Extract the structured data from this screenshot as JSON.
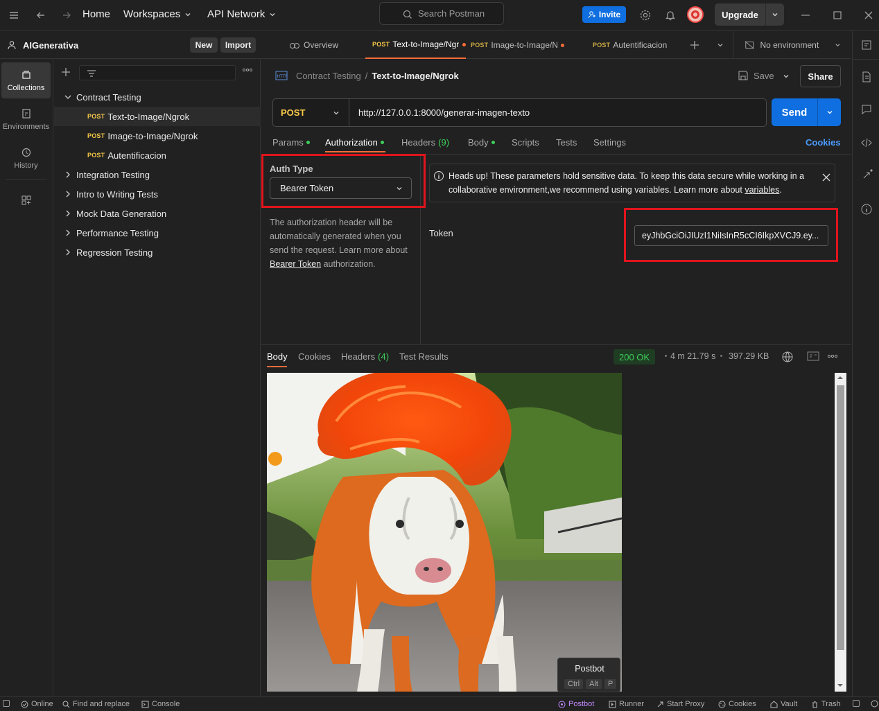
{
  "topbar": {
    "nav": {
      "home": "Home",
      "workspaces": "Workspaces",
      "api_network": "API Network"
    },
    "search_placeholder": "Search Postman",
    "invite_label": "Invite",
    "upgrade_label": "Upgrade"
  },
  "workspace": {
    "name": "AIGenerativa",
    "new_label": "New",
    "import_label": "Import"
  },
  "rail": [
    {
      "label": "Collections",
      "icon": "collections-icon"
    },
    {
      "label": "Environments",
      "icon": "environments-icon"
    },
    {
      "label": "History",
      "icon": "history-icon"
    }
  ],
  "sidebar": {
    "collections": [
      {
        "name": "Contract Testing",
        "expanded": true,
        "requests": [
          {
            "method": "POST",
            "name": "Text-to-Image/Ngrok"
          },
          {
            "method": "POST",
            "name": "Image-to-Image/Ngrok"
          },
          {
            "method": "POST",
            "name": "Autentificacion"
          }
        ]
      },
      {
        "name": "Integration Testing"
      },
      {
        "name": "Intro to Writing Tests"
      },
      {
        "name": "Mock Data Generation"
      },
      {
        "name": "Performance Testing"
      },
      {
        "name": "Regression Testing"
      }
    ]
  },
  "tabs": [
    {
      "label": "Overview"
    },
    {
      "method": "POST",
      "label": "Text-to-Image/Ngrok"
    },
    {
      "method": "POST",
      "label": "Image-to-Image/Ngrok"
    },
    {
      "method": "POST",
      "label": "Autentificacion"
    }
  ],
  "environment": "No environment",
  "request": {
    "breadcrumb_parent": "Contract Testing",
    "breadcrumb_sep": "/",
    "title": "Text-to-Image/Ngrok",
    "save_label": "Save",
    "share_label": "Share",
    "method": "POST",
    "url": "http://127.0.0.1:8000/generar-imagen-texto",
    "send_label": "Send",
    "tabs": {
      "params": "Params",
      "authorization": "Authorization",
      "headers": "Headers",
      "headers_count": "(9)",
      "body": "Body",
      "scripts": "Scripts",
      "tests": "Tests",
      "settings": "Settings",
      "cookies": "Cookies"
    }
  },
  "auth": {
    "type_label": "Auth Type",
    "type_value": "Bearer Token",
    "desc_1": "The authorization header will be automatically generated when you send the request. Learn more about ",
    "desc_link": "Bearer Token",
    "desc_2": " authorization.",
    "notice": "Heads up! These parameters hold sensitive data. To keep this data secure while working in a collaborative environment,we recommend using variables. Learn more about ",
    "notice_link": "variables",
    "notice_end": ".",
    "token_label": "Token",
    "token_value": "eyJhbGciOiJIUzI1NiIsInR5cCI6IkpXVCJ9.ey..."
  },
  "response": {
    "tabs": {
      "body": "Body",
      "cookies": "Cookies",
      "headers": "Headers",
      "headers_count": "(4)",
      "test_results": "Test Results"
    },
    "status": "200 OK",
    "time": "4 m 21.79 s",
    "size": "397.29 KB"
  },
  "tooltip": {
    "title": "Postbot",
    "keys": [
      "Ctrl",
      "Alt",
      "P"
    ]
  },
  "statusbar": {
    "online": "Online",
    "find": "Find and replace",
    "console": "Console",
    "postbot": "Postbot",
    "runner": "Runner",
    "proxy": "Start Proxy",
    "cookies": "Cookies",
    "vault": "Vault",
    "trash": "Trash"
  },
  "colors": {
    "accent": "#ff6c37",
    "primary": "#0f6fe0",
    "post": "#f7c948",
    "success": "#3ecf5a",
    "highlight": "#e0141c"
  }
}
